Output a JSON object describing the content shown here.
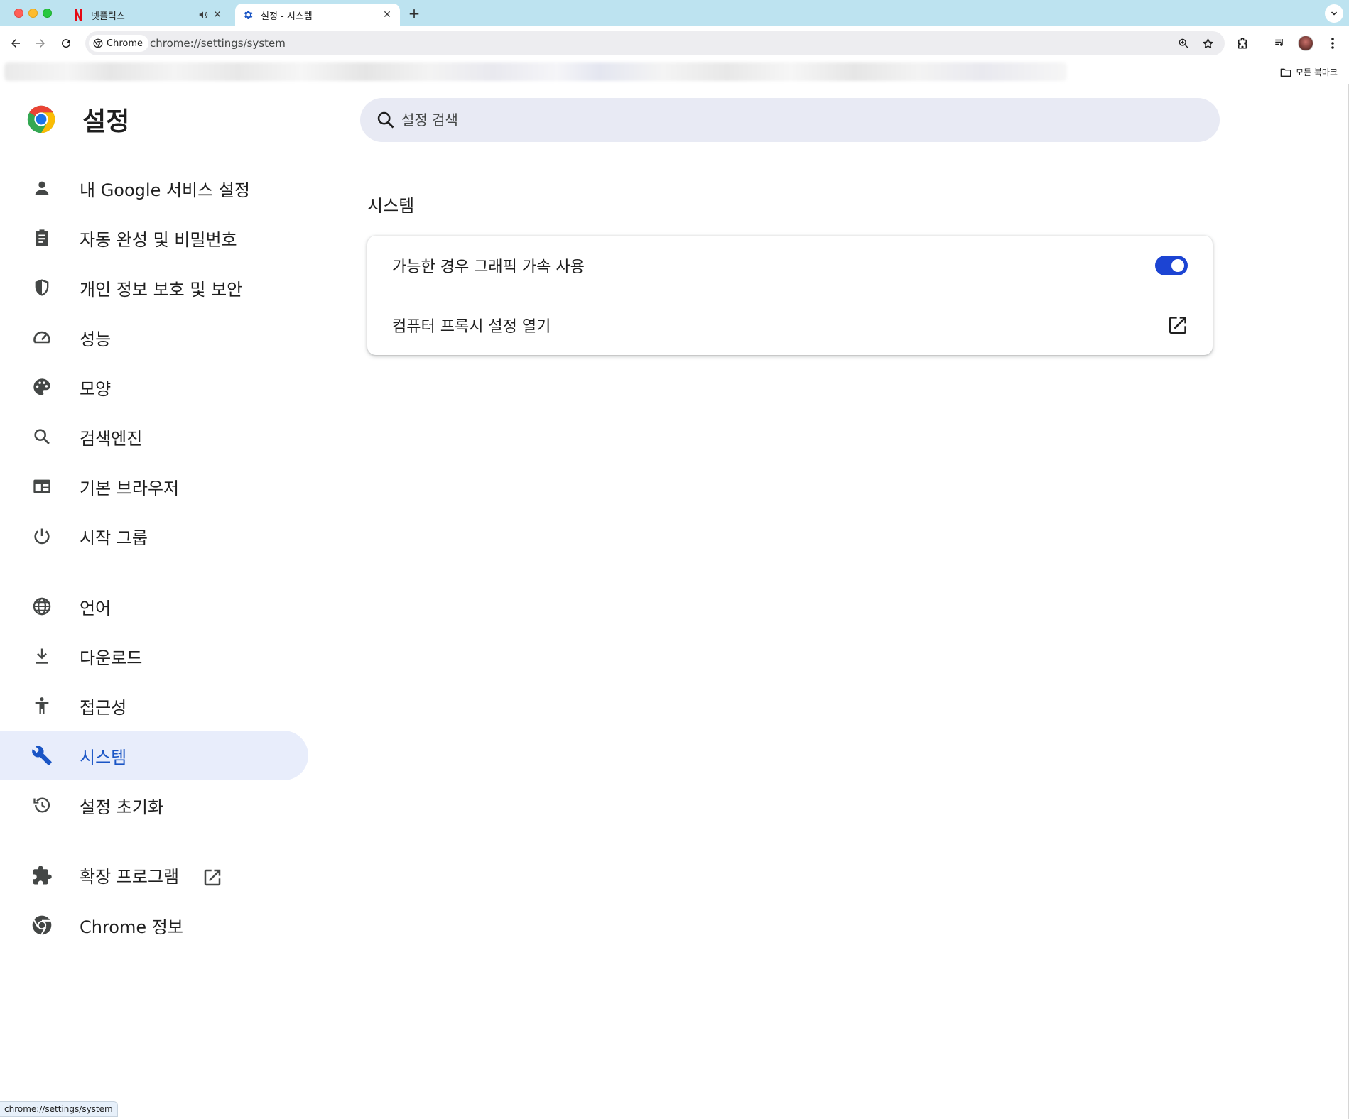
{
  "colors": {
    "tabstrip_bg": "#bde3f0",
    "accent_blue": "#1a55c5",
    "toggle_blue": "#1c44d3",
    "selected_nav_bg": "#e8edfb",
    "search_bg": "#e8eaf4",
    "netflix_red": "#e50914"
  },
  "tabs": [
    {
      "title": "넷플릭스",
      "icon": "netflix-icon",
      "audio": true
    },
    {
      "title": "설정 - 시스템",
      "icon": "gear-icon",
      "active": true
    }
  ],
  "toolbar": {
    "chip_label": "Chrome",
    "url": "chrome://settings/system"
  },
  "bookmarks": {
    "all_bookmarks_label": "모든 북마크"
  },
  "settings": {
    "title": "설정",
    "search_placeholder": "설정 검색"
  },
  "nav": {
    "items": [
      {
        "label": "내 Google 서비스 설정",
        "icon": "person-icon"
      },
      {
        "label": "자동 완성 및 비밀번호",
        "icon": "clipboard-icon"
      },
      {
        "label": "개인 정보 보호 및 보안",
        "icon": "shield-icon"
      },
      {
        "label": "성능",
        "icon": "speedometer-icon"
      },
      {
        "label": "모양",
        "icon": "palette-icon"
      },
      {
        "label": "검색엔진",
        "icon": "search-icon"
      },
      {
        "label": "기본 브라우저",
        "icon": "browser-icon"
      },
      {
        "label": "시작 그룹",
        "icon": "power-icon"
      },
      {
        "label": "언어",
        "icon": "globe-icon"
      },
      {
        "label": "다운로드",
        "icon": "download-icon"
      },
      {
        "label": "접근성",
        "icon": "accessibility-icon"
      },
      {
        "label": "시스템",
        "icon": "wrench-icon",
        "selected": true
      },
      {
        "label": "설정 초기화",
        "icon": "restore-icon"
      },
      {
        "label": "확장 프로그램",
        "icon": "puzzle-icon"
      },
      {
        "label": "Chrome 정보",
        "icon": "chrome-icon"
      }
    ]
  },
  "system": {
    "section_title": "시스템",
    "hardware_accel_label": "가능한 경우 그래픽 가속 사용",
    "hardware_accel_enabled": true,
    "proxy_label": "컴퓨터 프록시 설정 열기"
  },
  "status": {
    "hover_url": "chrome://settings/system"
  }
}
